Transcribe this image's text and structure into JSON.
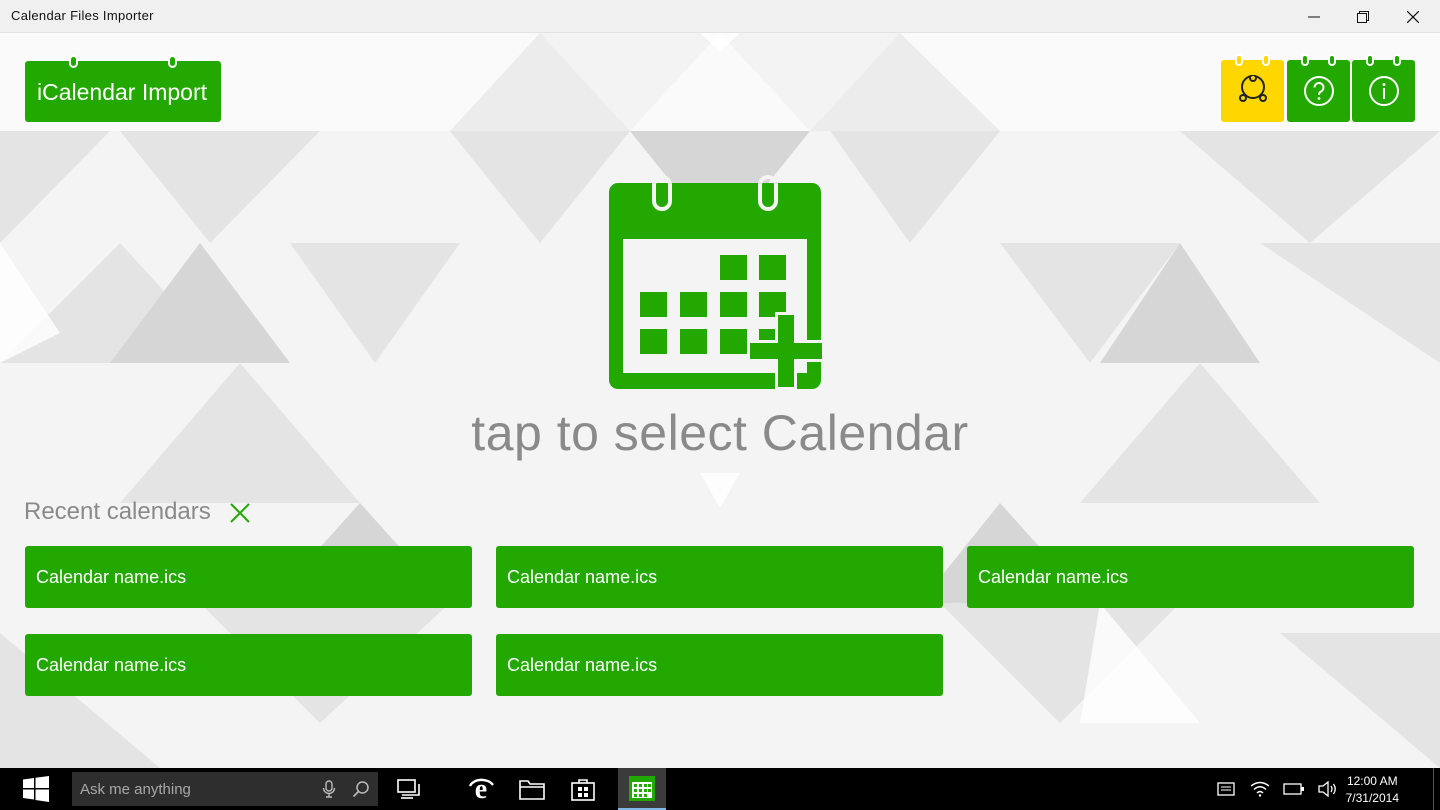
{
  "window": {
    "title": "Calendar Files Importer"
  },
  "header": {
    "app_button_label": "iCalendar Import",
    "tools": [
      {
        "name": "share",
        "icon": "share-icon",
        "color": "#ffd700"
      },
      {
        "name": "help",
        "icon": "help-icon",
        "color": "#22a800"
      },
      {
        "name": "info",
        "icon": "info-icon",
        "color": "#22a800"
      }
    ]
  },
  "main": {
    "select_prompt": "tap to select Calendar",
    "recent_label": "Recent calendars",
    "recent_items": [
      {
        "label": "Calendar name.ics"
      },
      {
        "label": "Calendar name.ics"
      },
      {
        "label": "Calendar name.ics"
      },
      {
        "label": "Calendar name.ics"
      },
      {
        "label": "Calendar name.ics"
      }
    ]
  },
  "taskbar": {
    "search_placeholder": "Ask me anything",
    "time": "12:00 AM",
    "date": "7/31/2014"
  },
  "colors": {
    "accent": "#22a800",
    "share": "#ffd700",
    "taskbar": "#000000"
  }
}
